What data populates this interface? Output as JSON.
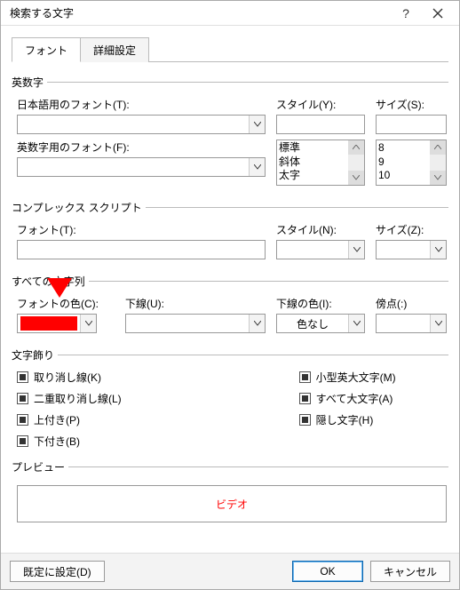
{
  "titlebar": {
    "title": "検索する文字"
  },
  "tabs": {
    "font": "フォント",
    "advanced": "詳細設定"
  },
  "groups": {
    "alnum": "英数字",
    "complex": "コンプレックス スクリプト",
    "alltext": "すべての文字列",
    "decoration": "文字飾り",
    "preview": "プレビュー"
  },
  "labels": {
    "ja_font": "日本語用のフォント(T):",
    "en_font": "英数字用のフォント(F):",
    "style_y": "スタイル(Y):",
    "size_s": "サイズ(S):",
    "complex_font": "フォント(T):",
    "style_n": "スタイル(N):",
    "size_z": "サイズ(Z):",
    "font_color": "フォントの色(C):",
    "underline": "下線(U):",
    "underline_color": "下線の色(I):",
    "emphasis": "傍点(:)"
  },
  "styles": {
    "s0": "標準",
    "s1": "斜体",
    "s2": "太字"
  },
  "sizes": {
    "z0": "8",
    "z1": "9",
    "z2": "10"
  },
  "underline_color_val": "色なし",
  "decor": {
    "strike": "取り消し線(K)",
    "dstrike": "二重取り消し線(L)",
    "super": "上付き(P)",
    "sub": "下付き(B)",
    "smallcaps": "小型英大文字(M)",
    "allcaps": "すべて大文字(A)",
    "hidden": "隠し文字(H)"
  },
  "preview_text": "ビデオ",
  "buttons": {
    "setdefault": "既定に設定(D)",
    "ok": "OK",
    "cancel": "キャンセル"
  }
}
